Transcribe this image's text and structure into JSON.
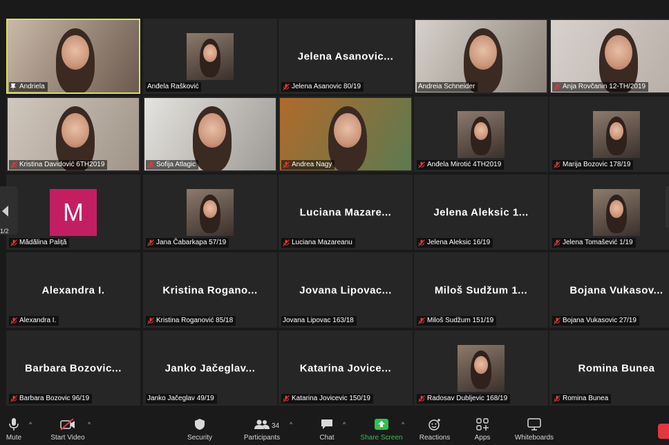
{
  "tiles": [
    {
      "label": "Andriela",
      "big": "",
      "muted": false,
      "pinned": true,
      "active": true,
      "kind": "video"
    },
    {
      "label": "Anđela Rašković",
      "big": "",
      "muted": false,
      "pinned": false,
      "kind": "thumb"
    },
    {
      "label": "Jelena Asanovic 80/19",
      "big": "Jelena  Asanovic...",
      "muted": true,
      "kind": "name"
    },
    {
      "label": "Andreia Schneider",
      "big": "",
      "muted": false,
      "kind": "video"
    },
    {
      "label": "Anja Rovčanin 12-TH/2019",
      "big": "",
      "muted": true,
      "kind": "video"
    },
    {
      "label": "Kristina Davidović 6TH2019",
      "big": "",
      "muted": true,
      "kind": "video"
    },
    {
      "label": "Sofija Atlagic",
      "big": "",
      "muted": true,
      "kind": "video"
    },
    {
      "label": "Andrea Nagy",
      "big": "",
      "muted": true,
      "kind": "video"
    },
    {
      "label": "Anđela Mirotić 4TH2019",
      "big": "",
      "muted": true,
      "kind": "thumb"
    },
    {
      "label": "Marija Bozovic 178/19",
      "big": "",
      "muted": true,
      "kind": "thumb"
    },
    {
      "label": "Mădălina Paliță",
      "big": "",
      "muted": true,
      "kind": "avatar",
      "avatar": "M"
    },
    {
      "label": "Jana Čabarkapa 57/19",
      "big": "",
      "muted": true,
      "kind": "thumb"
    },
    {
      "label": "Luciana Mazareanu",
      "big": "Luciana  Mazare...",
      "muted": true,
      "kind": "name"
    },
    {
      "label": "Jelena Aleksic 16/19",
      "big": "Jelena  Aleksic  1...",
      "muted": true,
      "kind": "name"
    },
    {
      "label": "Jelena Tomašević 1/19",
      "big": "",
      "muted": true,
      "kind": "thumb"
    },
    {
      "label": "Alexandra I.",
      "big": "Alexandra  I.",
      "muted": true,
      "kind": "name"
    },
    {
      "label": "Kristina Roganović 85/18",
      "big": "Kristina  Rogano...",
      "muted": true,
      "kind": "name"
    },
    {
      "label": "Jovana Lipovac 163/18",
      "big": "Jovana  Lipovac...",
      "muted": false,
      "kind": "name"
    },
    {
      "label": "Miloš Sudžum 151/19",
      "big": "Miloš  Sudžum  1...",
      "muted": true,
      "kind": "name"
    },
    {
      "label": "Bojana Vukasovic 27/19",
      "big": "Bojana  Vukasov...",
      "muted": true,
      "kind": "name"
    },
    {
      "label": "Barbara Bozovic 96/19",
      "big": "Barbara  Bozovic...",
      "muted": true,
      "kind": "name"
    },
    {
      "label": "Janko Jačeglav 49/19",
      "big": "Janko  Jačeglav...",
      "muted": false,
      "kind": "name"
    },
    {
      "label": "Katarina Jovicevic 150/19",
      "big": "Katarina  Jovice...",
      "muted": true,
      "kind": "name"
    },
    {
      "label": "Radosav Dubljevic 168/19",
      "big": "",
      "muted": true,
      "kind": "thumb"
    },
    {
      "label": "Romina Bunea",
      "big": "Romina Bunea",
      "muted": true,
      "kind": "name"
    }
  ],
  "page_indicator": "1/2",
  "toolbar": {
    "mute": "Mute",
    "start_video": "Start Video",
    "security": "Security",
    "participants": "Participants",
    "participants_count": "34",
    "chat": "Chat",
    "share_screen": "Share Screen",
    "reactions": "Reactions",
    "apps": "Apps",
    "whiteboards": "Whiteboards"
  },
  "colors": {
    "active_border": "#d6e25a",
    "share_green": "#2bc34f",
    "muted_red": "#e0383e",
    "avatar_pink": "#c41e63"
  }
}
